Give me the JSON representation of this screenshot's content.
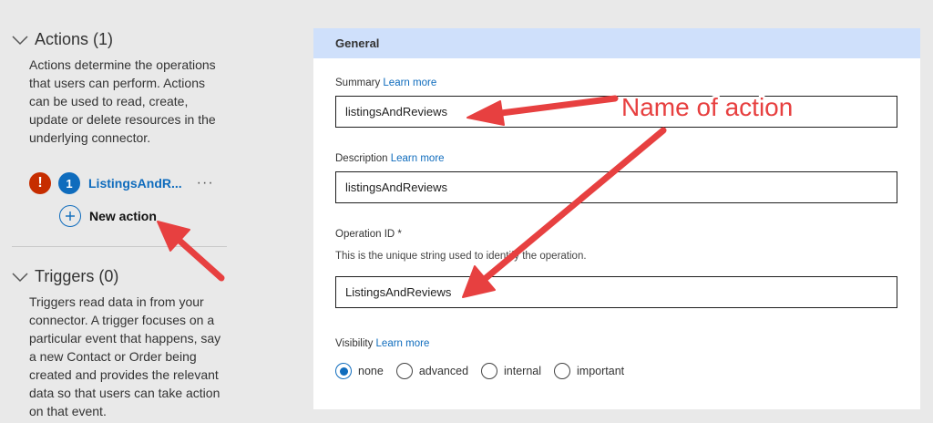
{
  "sidebar": {
    "actions": {
      "title": "Actions (1)",
      "description": "Actions determine the operations that users can perform. Actions can be used to read, create, update or delete resources in the underlying connector.",
      "items": [
        {
          "number": "1",
          "name": "ListingsAndR...",
          "error": "!",
          "more": "···"
        }
      ],
      "new_label": "New action"
    },
    "triggers": {
      "title": "Triggers (0)",
      "description": "Triggers read data in from your connector. A trigger focuses on a particular event that happens, say a new Contact or Order being created and provides the relevant data so that users can take action on that event."
    }
  },
  "panel": {
    "header": "General",
    "summary": {
      "label": "Summary",
      "link": "Learn more",
      "value": "listingsAndReviews"
    },
    "description": {
      "label": "Description",
      "link": "Learn more",
      "value": "listingsAndReviews"
    },
    "operation_id": {
      "label": "Operation ID *",
      "help": "This is the unique string used to identify the operation.",
      "value": "ListingsAndReviews"
    },
    "visibility": {
      "label": "Visibility",
      "link": "Learn more",
      "options": [
        "none",
        "advanced",
        "internal",
        "important"
      ],
      "selected": "none"
    }
  },
  "annotation": {
    "text": "Name of action",
    "color": "#e74040"
  },
  "colors": {
    "accent": "#0f6cbd",
    "error": "#c62d00",
    "header_bg": "#cfe0fb"
  }
}
